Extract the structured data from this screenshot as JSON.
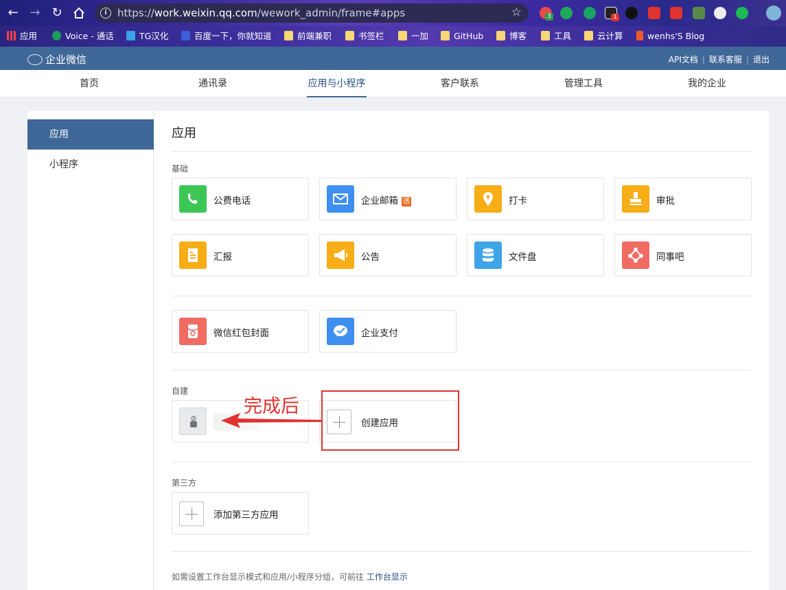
{
  "browser": {
    "url_prefix": "https://",
    "url_host": "work.weixin.qq.com",
    "url_path": "/wework_admin/frame#apps",
    "ext_badges": [
      "3",
      "1"
    ],
    "bookmarks": [
      {
        "label": "应用",
        "icon": "apps-grid-icon"
      },
      {
        "label": "Voice - 通话",
        "icon": "voice-icon"
      },
      {
        "label": "TG汉化",
        "icon": "telegram-icon"
      },
      {
        "label": "百度一下，你就知道",
        "icon": "baidu-icon"
      },
      {
        "label": "前端兼职",
        "icon": "folder-icon"
      },
      {
        "label": "书签栏",
        "icon": "folder-icon"
      },
      {
        "label": "一加",
        "icon": "folder-icon"
      },
      {
        "label": "GitHub",
        "icon": "folder-icon"
      },
      {
        "label": "博客",
        "icon": "folder-icon"
      },
      {
        "label": "工具",
        "icon": "folder-icon"
      },
      {
        "label": "云计算",
        "icon": "folder-icon"
      },
      {
        "label": "wenhs'S Blog",
        "icon": "blog-icon"
      }
    ]
  },
  "header": {
    "logo_text": "企业微信",
    "links": [
      "API文档",
      "联系客服",
      "退出"
    ]
  },
  "topnav": {
    "items": [
      "首页",
      "通讯录",
      "应用与小程序",
      "客户联系",
      "管理工具",
      "我的企业"
    ],
    "active": "应用与小程序"
  },
  "sidebar": {
    "items": [
      "应用",
      "小程序"
    ],
    "active": "应用"
  },
  "main": {
    "title": "应用",
    "sections": {
      "basic": "基础",
      "custom": "自建",
      "third_party": "第三方"
    },
    "basic_apps": [
      {
        "name": "公费电话",
        "icon": "phone-icon",
        "color": "#3cc655"
      },
      {
        "name": "企业邮箱",
        "icon": "mail-icon",
        "color": "#3e8ff0",
        "badge": "送"
      },
      {
        "name": "打卡",
        "icon": "location-pin-icon",
        "color": "#f6ad16"
      },
      {
        "name": "审批",
        "icon": "stamp-icon",
        "color": "#f6ad16"
      },
      {
        "name": "汇报",
        "icon": "report-icon",
        "color": "#f6ad16"
      },
      {
        "name": "公告",
        "icon": "megaphone-icon",
        "color": "#f6ad16"
      },
      {
        "name": "文件盘",
        "icon": "database-icon",
        "color": "#3fa5e8"
      },
      {
        "name": "同事吧",
        "icon": "network-icon",
        "color": "#f06b62"
      }
    ],
    "extra_apps": [
      {
        "name": "微信红包封面",
        "icon": "red-envelope-icon",
        "color": "#f06b62"
      },
      {
        "name": "企业支付",
        "icon": "wechat-pay-icon",
        "color": "#3e8ff0"
      }
    ],
    "create_app_label": "创建应用",
    "add_third_party_label": "添加第三方应用",
    "footer_text": "如需设置工作台显示模式和应用/小程序分组，可前往",
    "footer_link": "工作台显示"
  },
  "annotation": {
    "text": "完成后",
    "color": "#e0322f"
  }
}
